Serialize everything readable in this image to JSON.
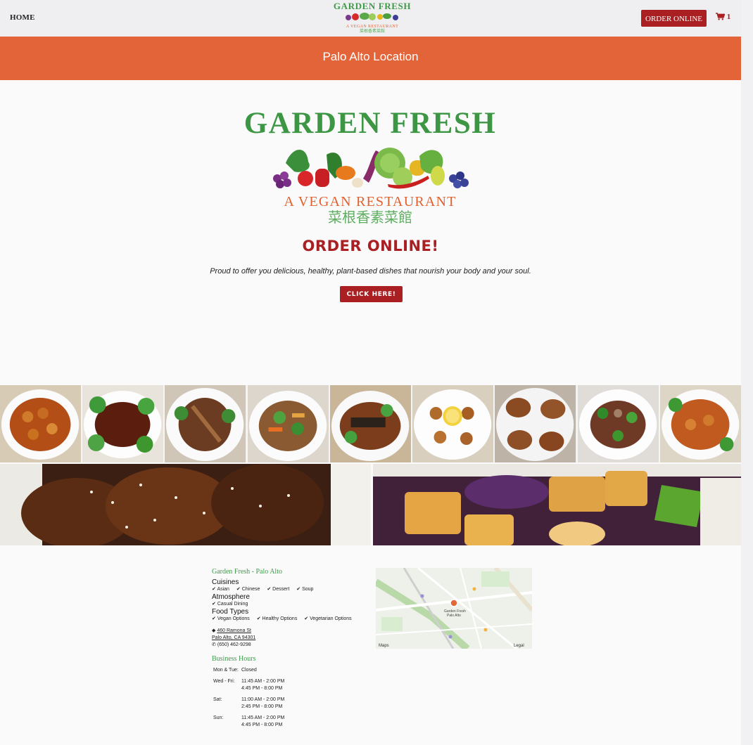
{
  "nav": {
    "home_label": "HOME",
    "order_online_label": "ORDER ONLINE",
    "cart_count": "1",
    "logo_title": "GARDEN FRESH",
    "logo_subtitle": "A VEGAN RESTAURANT",
    "logo_chinese": "菜根香素菜館"
  },
  "location_bar": {
    "title": "Palo Alto Location"
  },
  "hero": {
    "logo_title": "GARDEN FRESH",
    "logo_subtitle": "A VEGAN RESTAURANT",
    "logo_chinese": "菜根香素菜館",
    "heading": "ORDER ONLINE!",
    "tagline": "Proud to offer you delicious, healthy, plant-based dishes that nourish your body and your soul.",
    "cta_label": "CLICK HERE!"
  },
  "restaurant": {
    "name": "Garden Fresh - Palo Alto",
    "cuisines_label": "Cuisines",
    "cuisines": [
      "Asian",
      "Chinese",
      "Dessert",
      "Soup"
    ],
    "atmosphere_label": "Atmosphere",
    "atmosphere": [
      "Casual Dining"
    ],
    "food_types_label": "Food Types",
    "food_types": [
      "Vegan Options",
      "Healthy Options",
      "Vegetarian Options"
    ],
    "address_line1": "460 Ramona St",
    "address_line2": "Palo Alto, CA 94301",
    "phone": "(650) 462-9298"
  },
  "hours": {
    "title": "Business Hours",
    "rows": [
      {
        "days": "Mon & Tue:",
        "times": [
          "Closed"
        ]
      },
      {
        "days": "Wed - Fri:",
        "times": [
          "11:45 AM - 2:00 PM",
          "4:45 PM - 8:00 PM"
        ]
      },
      {
        "days": "Sat:",
        "times": [
          "11:00 AM - 2:00 PM",
          "2:45 PM - 8:00 PM"
        ]
      },
      {
        "days": "Sun:",
        "times": [
          "11:45 AM - 2:00 PM",
          "4:45 PM - 8:00 PM"
        ]
      }
    ]
  },
  "map": {
    "place_label_1": "Garden Fresh",
    "place_label_2": "Palo Alto",
    "maps_credit": "Maps",
    "legal_label": "Legal"
  },
  "colors": {
    "brand_red": "#a91f22",
    "location_orange": "#e4643a",
    "logo_green": "#3c9644"
  }
}
